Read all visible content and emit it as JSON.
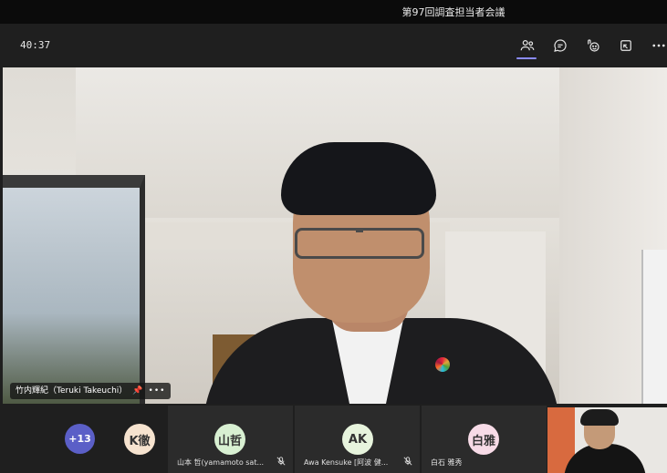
{
  "window": {
    "title": "第97回調査担当者会議"
  },
  "toolbar": {
    "timer": "40:37",
    "buttons": [
      {
        "name": "participants-icon"
      },
      {
        "name": "chat-icon"
      },
      {
        "name": "reactions-icon"
      },
      {
        "name": "share-screen-icon"
      },
      {
        "name": "more-icon"
      }
    ]
  },
  "main_video": {
    "speaker_name": "竹内輝紀（Teruki Takeuchi）",
    "pin_icon": "pin-icon",
    "more_icon": "more-options-icon"
  },
  "participants": {
    "overflow_count": "+13",
    "tiles": [
      {
        "avatar": "K徹",
        "avatar_color": "#f6e3cf",
        "label": ""
      },
      {
        "avatar": "山哲",
        "avatar_color": "#d8f0d2",
        "label": "山本 哲(yamamoto sat..."
      },
      {
        "avatar": "AK",
        "avatar_color": "#e7f4dd",
        "label": "Awa Kensuke [阿波 健..."
      },
      {
        "avatar": "白雅",
        "avatar_color": "#f7dbe7",
        "label": "白石 雅秀"
      }
    ]
  },
  "colors": {
    "accent": "#8b8cff",
    "overflow_badge": "#5b5fc7"
  }
}
